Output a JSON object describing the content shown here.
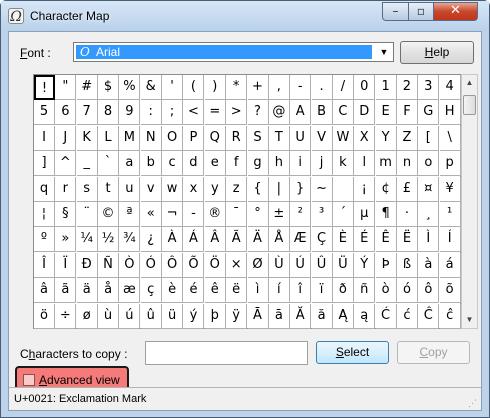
{
  "window": {
    "title": "Character Map",
    "minimize": "–",
    "maximize": "▫",
    "close": "✕"
  },
  "font_row": {
    "label_accel": "F",
    "label_rest": "ont :",
    "selected_font": "Arial",
    "help_accel": "H",
    "help_rest": "elp"
  },
  "characters": [
    [
      "!",
      "\"",
      "#",
      "$",
      "%",
      "&",
      "'",
      "(",
      ")",
      "*",
      "+",
      ",",
      "-",
      ".",
      "/",
      "0",
      "1",
      "2",
      "3",
      "4"
    ],
    [
      "5",
      "6",
      "7",
      "8",
      "9",
      ":",
      ";",
      "<",
      "=",
      ">",
      "?",
      "@",
      "A",
      "B",
      "C",
      "D",
      "E",
      "F",
      "G",
      "H"
    ],
    [
      "I",
      "J",
      "K",
      "L",
      "M",
      "N",
      "O",
      "P",
      "Q",
      "R",
      "S",
      "T",
      "U",
      "V",
      "W",
      "X",
      "Y",
      "Z",
      "[",
      "\\"
    ],
    [
      "]",
      "^",
      "_",
      "`",
      "a",
      "b",
      "c",
      "d",
      "e",
      "f",
      "g",
      "h",
      "i",
      "j",
      "k",
      "l",
      "m",
      "n",
      "o",
      "p"
    ],
    [
      "q",
      "r",
      "s",
      "t",
      "u",
      "v",
      "w",
      "x",
      "y",
      "z",
      "{",
      "|",
      "}",
      "~",
      " ",
      "¡",
      "¢",
      "£",
      "¤",
      "¥"
    ],
    [
      "¦",
      "§",
      "¨",
      "©",
      "ª",
      "«",
      "¬",
      "-",
      "®",
      "¯",
      "°",
      "±",
      "²",
      "³",
      "´",
      "µ",
      "¶",
      "·",
      "¸",
      "¹"
    ],
    [
      "º",
      "»",
      "¼",
      "½",
      "¾",
      "¿",
      "À",
      "Á",
      "Â",
      "Ã",
      "Ä",
      "Å",
      "Æ",
      "Ç",
      "È",
      "É",
      "Ê",
      "Ë",
      "Ì",
      "Í"
    ],
    [
      "Î",
      "Ï",
      "Ð",
      "Ñ",
      "Ò",
      "Ó",
      "Ô",
      "Õ",
      "Ö",
      "×",
      "Ø",
      "Ù",
      "Ú",
      "Û",
      "Ü",
      "Ý",
      "Þ",
      "ß",
      "à",
      "á"
    ],
    [
      "â",
      "ã",
      "ä",
      "å",
      "æ",
      "ç",
      "è",
      "é",
      "ê",
      "ë",
      "ì",
      "í",
      "î",
      "ï",
      "ð",
      "ñ",
      "ò",
      "ó",
      "ô",
      "õ"
    ],
    [
      "ö",
      "÷",
      "ø",
      "ù",
      "ú",
      "û",
      "ü",
      "ý",
      "þ",
      "ÿ",
      "Ā",
      "ā",
      "Ă",
      "ă",
      "Ą",
      "ą",
      "Ć",
      "ć",
      "Ĉ",
      "ĉ"
    ]
  ],
  "selected_char": "!",
  "copy_row": {
    "label_prefix": "C",
    "label_accel": "h",
    "label_rest": "aracters to copy :",
    "value": "",
    "select_accel": "S",
    "select_rest": "elect",
    "copy_accel": "C",
    "copy_rest": "opy"
  },
  "advanced": {
    "label_accel": "A",
    "label_rest": "dvanced view",
    "checked": false
  },
  "status": {
    "text": "U+0021: Exclamation Mark"
  },
  "colors": {
    "selection_blue": "#3399ff",
    "highlight_red": "#f57a7a"
  }
}
